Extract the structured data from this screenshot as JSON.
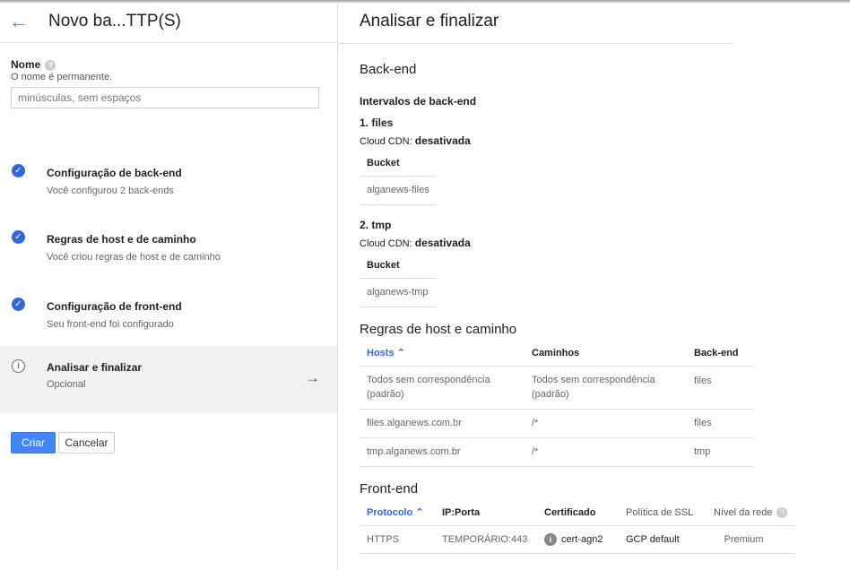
{
  "left": {
    "title": "Novo ba...TTP(S)",
    "name_label": "Nome",
    "name_hint": "O nome é permanente.",
    "name_placeholder": "minúsculas, sem espaços",
    "steps": [
      {
        "title": "Configuração de back-end",
        "subtitle": "Você configurou 2 back-ends",
        "status": "done"
      },
      {
        "title": "Regras de host e de caminho",
        "subtitle": "Você criou regras de host e de caminho",
        "status": "done"
      },
      {
        "title": "Configuração de front-end",
        "subtitle": "Seu front-end foi configurado",
        "status": "done"
      },
      {
        "title": "Analisar e finalizar",
        "subtitle": "Opcional",
        "status": "current"
      }
    ],
    "create": "Criar",
    "cancel": "Cancelar"
  },
  "right": {
    "title": "Analisar e finalizar",
    "backend_heading": "Back-end",
    "intervals_heading": "Intervalos de back-end",
    "backends": [
      {
        "name": "1. files",
        "cdn_label": "Cloud CDN:",
        "cdn_value": "desativada",
        "col": "Bucket",
        "bucket": "alganews-files"
      },
      {
        "name": "2. tmp",
        "cdn_label": "Cloud CDN:",
        "cdn_value": "desativada",
        "col": "Bucket",
        "bucket": "alganews-tmp"
      }
    ],
    "rules_heading": "Regras de host e caminho",
    "rules_cols": [
      "Hosts",
      "Caminhos",
      "Back-end"
    ],
    "rules": [
      {
        "host": "Todos sem correspondência (padrão)",
        "path": "Todos sem correspondência (padrão)",
        "backend": "files"
      },
      {
        "host": "files.alganews.com.br",
        "path": "/*",
        "backend": "files"
      },
      {
        "host": "tmp.alganews.com.br",
        "path": "/*",
        "backend": "tmp"
      }
    ],
    "frontend_heading": "Front-end",
    "fe_cols": [
      "Protocolo",
      "IP:Porta",
      "Certificado",
      "Política de SSL",
      "Nível da rede"
    ],
    "fe_rows": [
      {
        "protocol": "HTTPS",
        "ip": "TEMPORÁRIO:443",
        "cert": "cert-agn2",
        "ssl": "GCP default",
        "tier": "Premium"
      }
    ]
  }
}
